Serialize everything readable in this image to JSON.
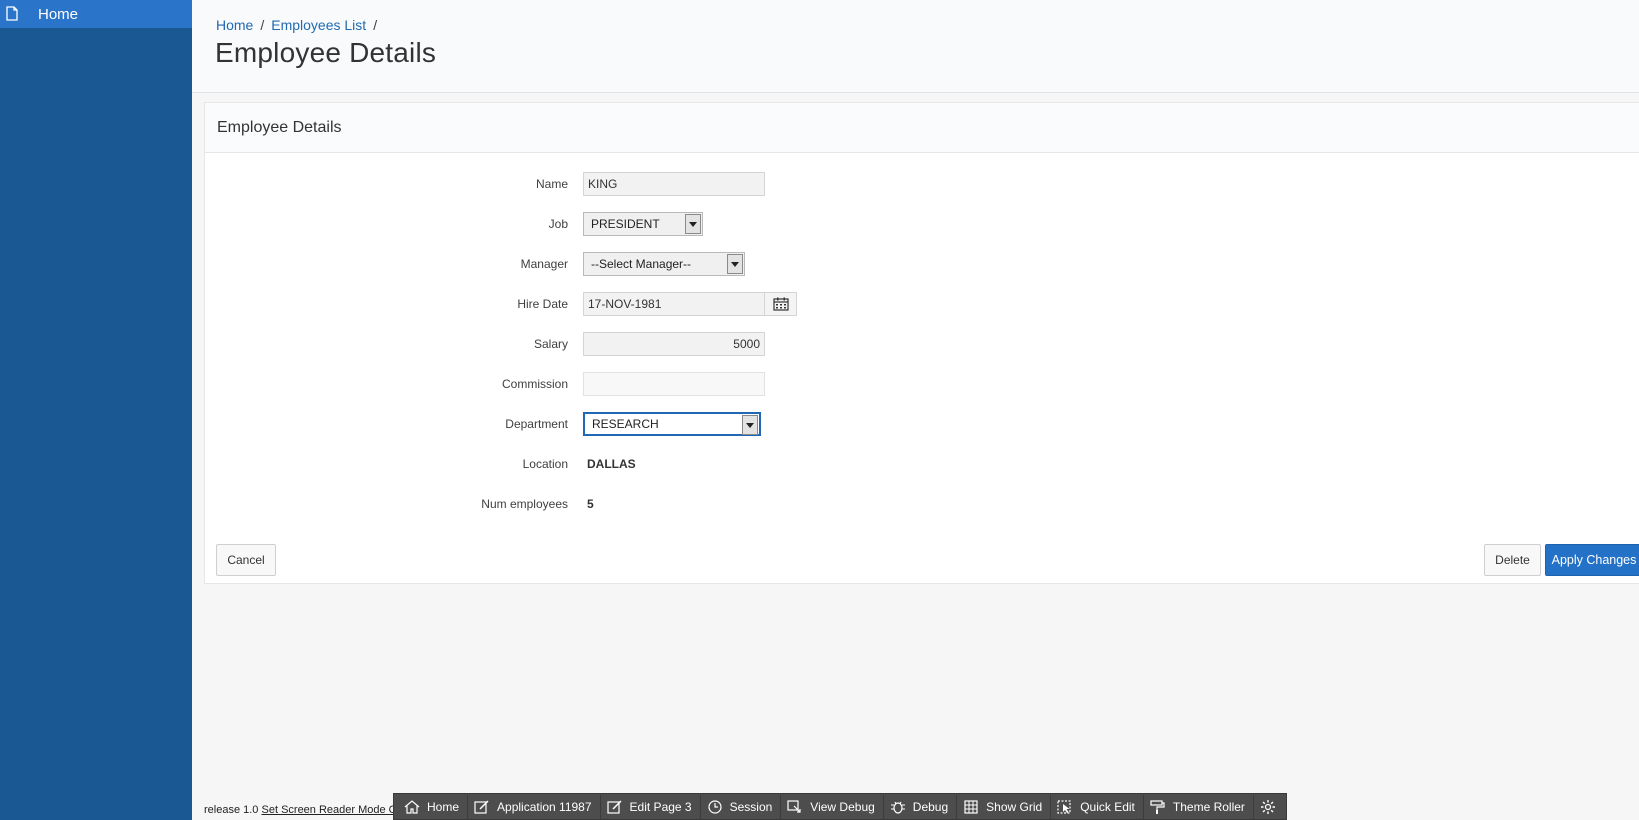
{
  "sidebar": {
    "items": [
      {
        "label": "Home",
        "icon": "page-icon"
      }
    ]
  },
  "breadcrumb": {
    "items": [
      {
        "label": "Home"
      },
      {
        "label": "Employees List"
      }
    ],
    "separator": "/"
  },
  "page_title": "Employee Details",
  "region": {
    "title": "Employee Details",
    "fields": {
      "name": {
        "label": "Name",
        "value": "KING"
      },
      "job": {
        "label": "Job",
        "value": "PRESIDENT"
      },
      "manager": {
        "label": "Manager",
        "value": "--Select Manager--"
      },
      "hire_date": {
        "label": "Hire Date",
        "value": "17-NOV-1981"
      },
      "salary": {
        "label": "Salary",
        "value": "5000"
      },
      "commission": {
        "label": "Commission",
        "value": ""
      },
      "department": {
        "label": "Department",
        "value": "RESEARCH"
      },
      "location": {
        "label": "Location",
        "value": "DALLAS"
      },
      "num_employees": {
        "label": "Num employees",
        "value": "5"
      }
    },
    "buttons": {
      "cancel": "Cancel",
      "delete": "Delete",
      "apply": "Apply Changes"
    }
  },
  "footer": {
    "release": "release 1.0",
    "screen_reader_link": "Set Screen Reader Mode On"
  },
  "dev_toolbar": {
    "items": [
      {
        "label": "Home",
        "icon": "home-icon"
      },
      {
        "label": "Application 11987",
        "icon": "edit-icon"
      },
      {
        "label": "Edit Page 3",
        "icon": "edit-icon"
      },
      {
        "label": "Session",
        "icon": "clock-icon"
      },
      {
        "label": "View Debug",
        "icon": "view-debug-icon"
      },
      {
        "label": "Debug",
        "icon": "bug-icon"
      },
      {
        "label": "Show Grid",
        "icon": "grid-icon"
      },
      {
        "label": "Quick Edit",
        "icon": "quick-edit-icon"
      },
      {
        "label": "Theme Roller",
        "icon": "paint-roller-icon"
      },
      {
        "label": "",
        "icon": "gear-icon"
      }
    ]
  },
  "colors": {
    "sidebar": "#1a5894",
    "nav_active": "#2a74c9",
    "primary_button": "#2471c8",
    "link": "#1f6ab0"
  }
}
